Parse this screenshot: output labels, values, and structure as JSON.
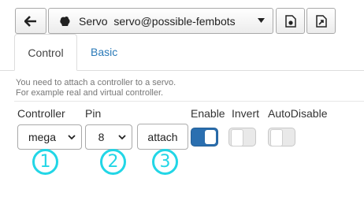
{
  "toolbar": {
    "back_icon": "arrow-left-icon",
    "service_icon": "servo-icon",
    "service_type": "Servo",
    "service_name": "servo@possible-fembots",
    "dropdown_icon": "caret-down-icon",
    "button1_icon": "file-gear-icon",
    "button2_icon": "file-export-icon"
  },
  "tabs": [
    {
      "label": "Control",
      "active": true
    },
    {
      "label": "Basic",
      "active": false
    }
  ],
  "hint": {
    "line1": "You need to attach a controller to a servo.",
    "line2": "For example real and virtual controller."
  },
  "labels": {
    "controller": "Controller",
    "pin": "Pin",
    "enable": "Enable",
    "invert": "Invert",
    "autodisable": "AutoDisable"
  },
  "controller_select": {
    "value": "mega"
  },
  "pin_select": {
    "value": "8"
  },
  "attach_button": {
    "label": "attach"
  },
  "toggles": {
    "enable": true,
    "invert": false,
    "autodisable": false
  },
  "markers": [
    "1",
    "2",
    "3"
  ],
  "colors": {
    "accent": "#2a6fb0",
    "link": "#2a7ab8",
    "marker": "#22d6e6"
  }
}
